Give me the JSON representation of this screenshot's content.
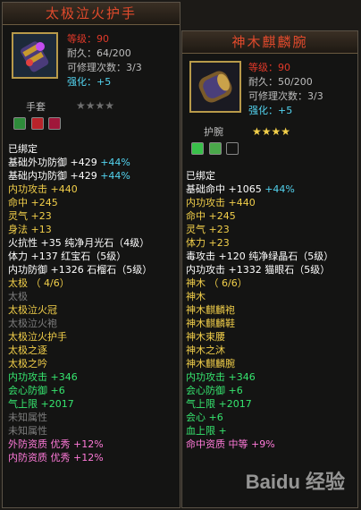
{
  "left_item": {
    "name": "太极泣火护手",
    "level": "等级：90",
    "durability": "耐久：64/200",
    "repair": "可修理次数：3/3",
    "enhance": "强化：+5",
    "slot_label": "手套",
    "stars_filled": 0,
    "stars_total": 4,
    "lines": [
      {
        "text": "已绑定",
        "color": "white"
      },
      {
        "text": "基础外功防御 +429 ",
        "extra": "+44%",
        "color": "white",
        "extra_color": "cyan"
      },
      {
        "text": "基础内功防御 +429 ",
        "extra": "+44%",
        "color": "white",
        "extra_color": "cyan"
      },
      {
        "text": "内功攻击 +440",
        "color": "gold"
      },
      {
        "text": "命中 +245",
        "color": "gold"
      },
      {
        "text": "灵气 +23",
        "color": "gold"
      },
      {
        "text": "身法 +13",
        "color": "gold"
      },
      {
        "text": "火抗性 +35 纯净月光石（4级）",
        "color": "white"
      },
      {
        "text": "体力 +137 红宝石（5级）",
        "color": "white"
      },
      {
        "text": "内功防御 +1326 石榴石（5级）",
        "color": "white"
      },
      {
        "text": "太极 （ 4/6）",
        "color": "gold"
      },
      {
        "text": "太极",
        "color": "dgray"
      },
      {
        "text": "太极泣火冠",
        "color": "gold"
      },
      {
        "text": "太极泣火袍",
        "color": "dgray"
      },
      {
        "text": "太极泣火护手",
        "color": "gold"
      },
      {
        "text": "太极之逐",
        "color": "gold"
      },
      {
        "text": "太极之吟",
        "color": "gold"
      },
      {
        "text": "内功攻击 +346",
        "color": "green"
      },
      {
        "text": "会心防御 +6",
        "color": "green"
      },
      {
        "text": "气上限 +2017",
        "color": "green"
      },
      {
        "text": "未知属性",
        "color": "dgray"
      },
      {
        "text": "未知属性",
        "color": "dgray"
      },
      {
        "text": "外防资质  优秀 +12%",
        "color": "pink"
      },
      {
        "text": "内防资质  优秀 +12%",
        "color": "pink"
      }
    ]
  },
  "right_item": {
    "name": "神木麒麟腕",
    "level": "等级：90",
    "durability": "耐久：50/200",
    "repair": "可修理次数：3/3",
    "enhance": "强化：+5",
    "slot_label": "护腕",
    "stars_filled": 4,
    "stars_total": 4,
    "lines": [
      {
        "text": "已绑定",
        "color": "white"
      },
      {
        "text": "基础命中 +1065 ",
        "extra": "+44%",
        "color": "white",
        "extra_color": "cyan"
      },
      {
        "text": "内功攻击 +440",
        "color": "gold"
      },
      {
        "text": "命中 +245",
        "color": "gold"
      },
      {
        "text": "灵气 +23",
        "color": "gold"
      },
      {
        "text": "体力 +23",
        "color": "gold"
      },
      {
        "text": "毒攻击 +120 纯净绿晶石（5级）",
        "color": "white"
      },
      {
        "text": "内功攻击 +1332 猫眼石（5级）",
        "color": "white"
      },
      {
        "text": "神木 （ 6/6）",
        "color": "gold"
      },
      {
        "text": "神木",
        "color": "gold"
      },
      {
        "text": "神木麒麟袍",
        "color": "gold"
      },
      {
        "text": "神木麒麟鞋",
        "color": "gold"
      },
      {
        "text": "神木束腰",
        "color": "gold"
      },
      {
        "text": "神木之沐",
        "color": "gold"
      },
      {
        "text": "神木麒麟腕",
        "color": "gold"
      },
      {
        "text": "内功攻击 +346",
        "color": "green"
      },
      {
        "text": "会心防御 +6",
        "color": "green"
      },
      {
        "text": "气上限 +2017",
        "color": "green"
      },
      {
        "text": "会心 +6",
        "color": "green"
      },
      {
        "text": "血上限 +",
        "color": "green"
      },
      {
        "text": "命中资质  中等 +9%",
        "color": "pink"
      }
    ]
  },
  "watermark": "Baidu 经验"
}
